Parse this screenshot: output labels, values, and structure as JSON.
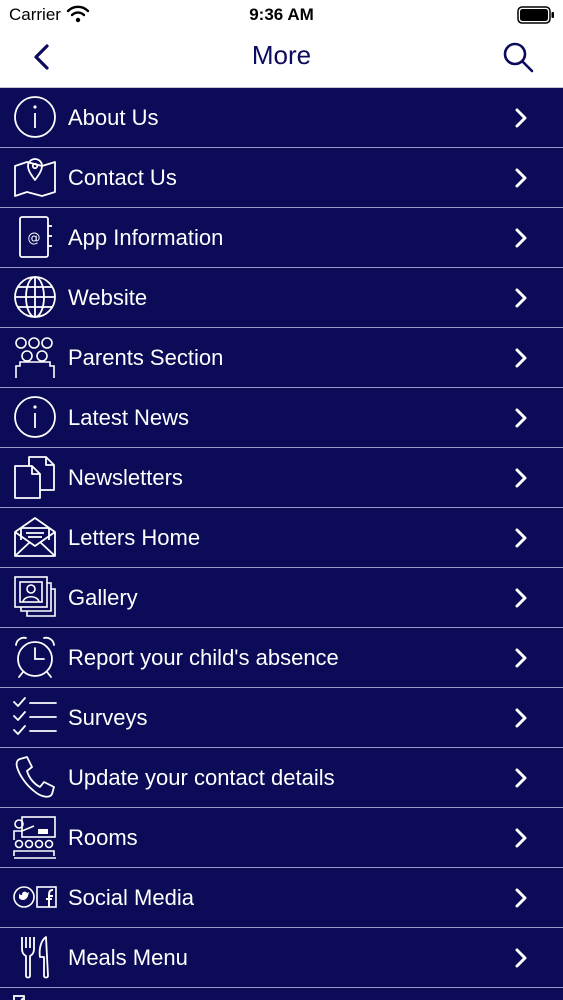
{
  "status_bar": {
    "carrier": "Carrier",
    "time": "9:36 AM"
  },
  "nav": {
    "title": "More"
  },
  "menu": {
    "items": [
      {
        "label": "About Us",
        "icon": "info-icon"
      },
      {
        "label": "Contact Us",
        "icon": "map-pin-icon"
      },
      {
        "label": "App Information",
        "icon": "address-book-icon"
      },
      {
        "label": "Website",
        "icon": "globe-icon"
      },
      {
        "label": "Parents Section",
        "icon": "group-icon"
      },
      {
        "label": "Latest News",
        "icon": "info-icon"
      },
      {
        "label": "Newsletters",
        "icon": "documents-icon"
      },
      {
        "label": "Letters Home",
        "icon": "envelope-icon"
      },
      {
        "label": "Gallery",
        "icon": "photos-icon"
      },
      {
        "label": "Report your child's absence",
        "icon": "alarm-clock-icon"
      },
      {
        "label": "Surveys",
        "icon": "checklist-icon"
      },
      {
        "label": "Update your contact details",
        "icon": "phone-icon"
      },
      {
        "label": "Rooms",
        "icon": "classroom-icon"
      },
      {
        "label": "Social Media",
        "icon": "social-icon"
      },
      {
        "label": "Meals Menu",
        "icon": "fork-knife-icon"
      }
    ]
  },
  "colors": {
    "menu_background": "#0b0b58",
    "accent": "#0c0a5c",
    "divider": "#9a9ac4"
  }
}
